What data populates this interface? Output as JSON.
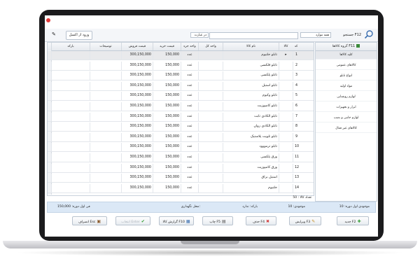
{
  "toolbar": {
    "excel_import_label": "ورود از اکسل",
    "search_label": "جستجو F12",
    "scope_value": "همه موارد",
    "filter_value": "در عبارت",
    "search_placeholder": ""
  },
  "table": {
    "columns": [
      "کد",
      "کالا",
      "نام کالا",
      "واحد کل",
      "واحد جزء",
      "قیمت خرید",
      "قیمت فروش",
      "توضیحات",
      "بارکد"
    ],
    "rows": [
      {
        "code": "1",
        "name": "تابلو جلتیوم",
        "unit_total": "",
        "unit_part": "عدد",
        "buy": "150,000",
        "sell": "300,150,000"
      },
      {
        "code": "2",
        "name": "تابلو فلکسی",
        "unit_total": "",
        "unit_part": "عدد",
        "buy": "150,000",
        "sell": "300,150,000"
      },
      {
        "code": "3",
        "name": "تابلو پلکسی",
        "unit_total": "",
        "unit_part": "عدد",
        "buy": "150,000",
        "sell": "300,150,000"
      },
      {
        "code": "4",
        "name": "تابلو استیل",
        "unit_total": "",
        "unit_part": "عدد",
        "buy": "150,000",
        "sell": "300,150,000"
      },
      {
        "code": "5",
        "name": "تابلو وکیوم",
        "unit_total": "",
        "unit_part": "عدد",
        "buy": "150,000",
        "sell": "300,150,000"
      },
      {
        "code": "6",
        "name": "تابلو کامپوزیت",
        "unit_total": "",
        "unit_part": "عدد",
        "buy": "150,000",
        "sell": "300,150,000"
      },
      {
        "code": "7",
        "name": "تابلو الکادی ثابت",
        "unit_total": "",
        "unit_part": "عدد",
        "buy": "150,000",
        "sell": "300,150,000"
      },
      {
        "code": "8",
        "name": "تابلو الکادی روان",
        "unit_total": "",
        "unit_part": "عدد",
        "buy": "150,000",
        "sell": "300,150,000"
      },
      {
        "code": "9",
        "name": "تابلو تلویت پلاستیک",
        "unit_total": "",
        "unit_part": "عدد",
        "buy": "150,000",
        "sell": "300,150,000"
      },
      {
        "code": "10",
        "name": "تابلو ترمووود",
        "unit_total": "",
        "unit_part": "عدد",
        "buy": "150,000",
        "sell": "300,150,000"
      },
      {
        "code": "11",
        "name": "ورق پلکسی",
        "unit_total": "",
        "unit_part": "عدد",
        "buy": "150,000",
        "sell": "300,150,000"
      },
      {
        "code": "12",
        "name": "ورق کامپوزیت",
        "unit_total": "",
        "unit_part": "عدد",
        "buy": "150,000",
        "sell": "300,150,000"
      },
      {
        "code": "13",
        "name": "استیل براق",
        "unit_total": "",
        "unit_part": "عدد",
        "buy": "150,000",
        "sell": "300,150,000"
      },
      {
        "code": "14",
        "name": "جلتیوم",
        "unit_total": "",
        "unit_part": "عدد",
        "buy": "150,000",
        "sell": "300,150,000"
      }
    ],
    "count_label": "تعداد کالا : 50"
  },
  "groups": {
    "header": "گروه کالاها F11",
    "items": [
      "کلیه کالاها",
      "کالاهای عمومی",
      "انواع تابلو",
      "مواد اولیه",
      "لوازم روشنایی",
      "ابزار و تجهیزات",
      "لوازم جانبی و نصب",
      "کالاهای غیر فعال"
    ]
  },
  "status": {
    "stock_first": "موجودی اول دوره: 10",
    "stock": "موجودی: 10",
    "barcode": "بارکد: ندارد",
    "location": "محل نگهداری:",
    "first_price": "فی اول دوره: 150,000"
  },
  "buttons": {
    "new": "جدید F2",
    "edit": "ویرایش F3",
    "delete": "حذف F4",
    "print": "چاپ F5",
    "report": "گزارش کالا F10",
    "confirm": "انتخاب Enter",
    "cancel": "انصراف Esc"
  }
}
